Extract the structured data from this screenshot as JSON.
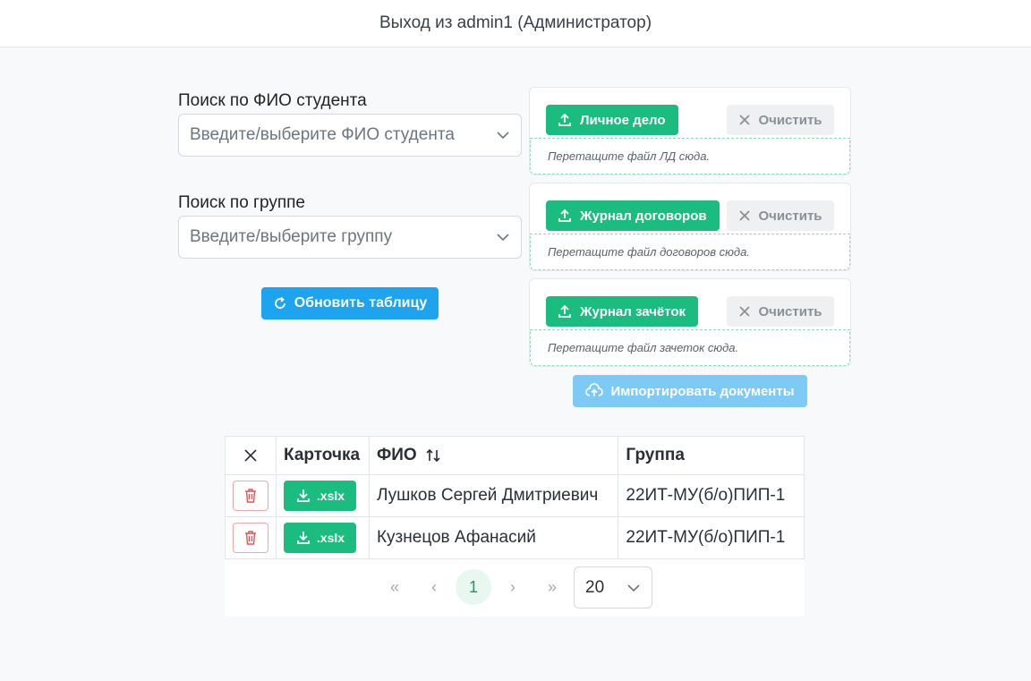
{
  "header": {
    "logout_text": "Выход из admin1 (Администратор)"
  },
  "search": {
    "student_label": "Поиск по ФИО студента",
    "student_placeholder": "Введите/выберите ФИО студента",
    "group_label": "Поиск по группе",
    "group_placeholder": "Введите/выберите группу",
    "refresh_label": "Обновить таблицу"
  },
  "uploads": [
    {
      "button": "Личное дело",
      "clear": "Очистить",
      "drop_hint": "Перетащите файл ЛД сюда."
    },
    {
      "button": "Журнал договоров",
      "clear": "Очистить",
      "drop_hint": "Перетащите файл договоров сюда."
    },
    {
      "button": "Журнал зачёток",
      "clear": "Очистить",
      "drop_hint": "Перетащите файл зачеток сюда."
    }
  ],
  "import_label": "Импортировать документы",
  "table": {
    "columns": [
      "",
      "Карточка",
      "ФИО",
      "Группа"
    ],
    "rows": [
      {
        "card_btn": ".xslx",
        "fio": "Лушков Сергей Дмитриевич",
        "group": "22ИТ-МУ(б/о)ПИП-1"
      },
      {
        "card_btn": ".xslx",
        "fio": "Кузнецов Афанасий",
        "group": "22ИТ-МУ(б/о)ПИП-1"
      }
    ]
  },
  "pagination": {
    "first": "«",
    "prev": "‹",
    "current": "1",
    "next": "›",
    "last": "»",
    "per_page": "20"
  },
  "colors": {
    "accent_green": "#1bbc7f",
    "accent_blue": "#1ea4ef",
    "import_disabled": "#7ccaf5",
    "delete_red": "#e25555"
  }
}
